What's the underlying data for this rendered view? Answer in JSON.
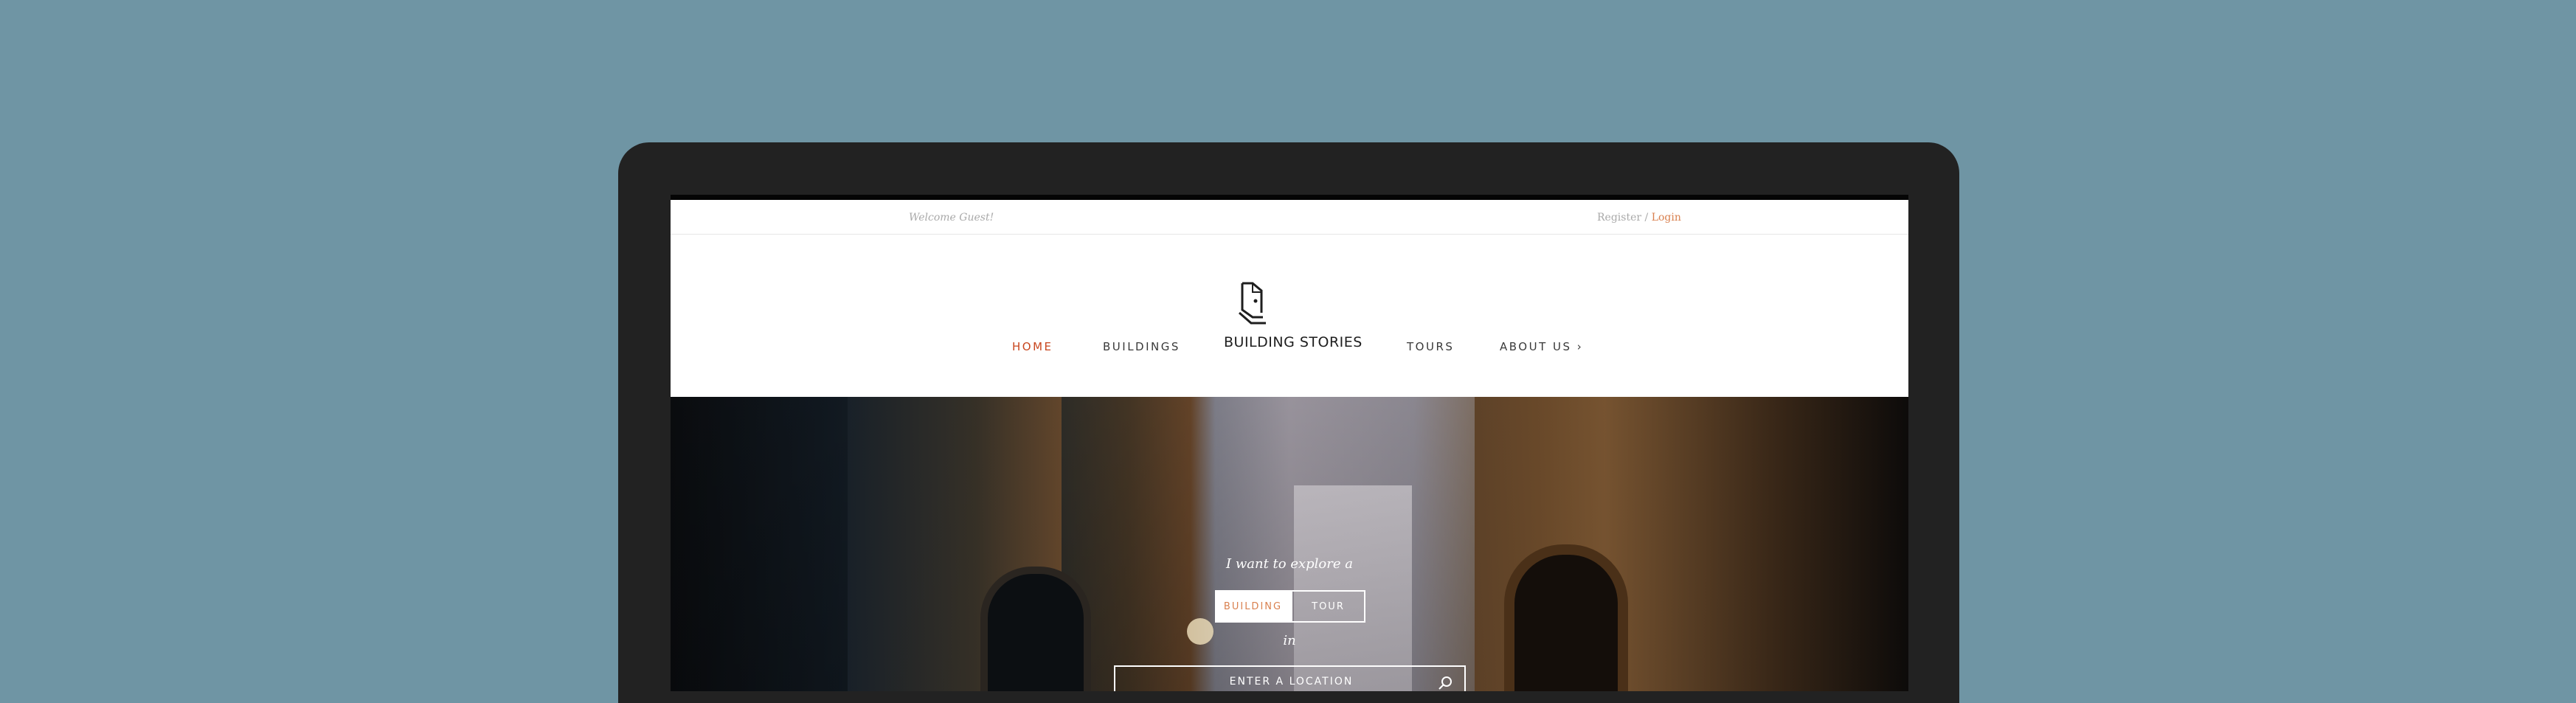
{
  "topbar": {
    "welcome": "Welcome Guest!",
    "register": "Register",
    "separator": "/",
    "login": "Login"
  },
  "nav": {
    "home": "HOME",
    "buildings": "BUILDINGS",
    "brand": "BUILDING STORIES",
    "tours": "TOURS",
    "about": "ABOUT US ›"
  },
  "hero": {
    "lead": "I want to explore a",
    "option_building": "BUILDING",
    "option_tour": "TOUR",
    "in_word": "in",
    "search_placeholder": "ENTER A LOCATION"
  },
  "colors": {
    "background": "#6f95a4",
    "accent": "#d9804f",
    "active_nav": "#c8461e"
  }
}
